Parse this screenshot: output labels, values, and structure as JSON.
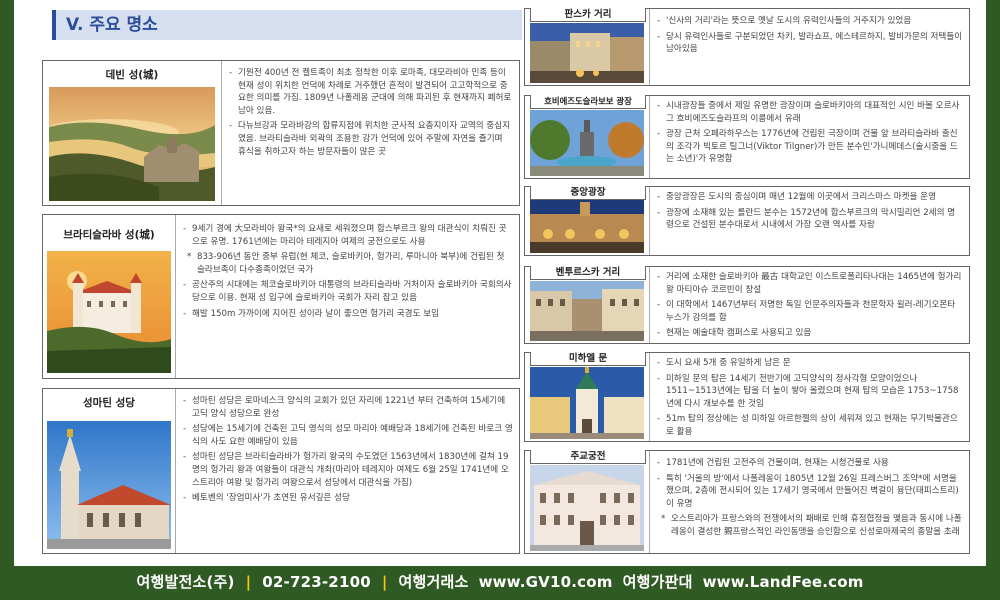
{
  "section": {
    "title": "V. 주요 명소"
  },
  "left_cards": [
    {
      "title": "데빈 성(城)",
      "items": [
        "기원전 400년 전 켈트족이 최초 정착한 이후 로마족, 대모라비아 민족 등이 현재 성이 위치한 언덕에 차례로 거주했던 흔적이 발견되어 고고학적으로 중요한 의미를 가짐. 1809년 나폴레옹 군대에 의해 파괴된 후 현재까지 폐허로 남아 있음.",
        "다뉴브강과 모라바강의 합류지점에 위치한 군사적 요충지이자 교역의 중심지였음. 브라티슬라바 외곽의 조용한 강가 언덕에 있어 주말에 자연을 즐기며 휴식을 취하고자 하는 방문자들이 많은 곳"
      ]
    },
    {
      "title": "브라티슬라바 성(城)",
      "items": [
        "9세기 경에 大모라비아 왕국*의 요새로 세워졌으며 합스부르크 왕의 대관식이 치뤄진 곳으로 유명. 1761년에는 마리아 테레지아 여제의 궁전으로도 사용",
        "833-906년 동안 중부 유럽(현 체코, 슬로바키아, 헝가리, 루마니아 북부)에 건립된 첫 슬라브족이 다수종족이었던 국가",
        "공산주의 시대에는 체코슬로바키아 대통령의 브라티슬라바 거처이자 슬로바키아 국회의사당으로 이용. 현재 성 입구에 슬로바키아 국회가 자리 잡고 있음",
        "해발 150m 가까이에 지어진 성이라 날이 좋으면 헝가리 국경도 보임"
      ]
    },
    {
      "title": "성마틴 성당",
      "items": [
        "성마틴 성당은 로마네스크 양식의 교회가 있던 자리에 1221년 부터 건축하여 15세기에 고딕 양식 성당으로 완성",
        "성당에는 15세기에 건축된 고딕 영식의 성모 마리아 예배당과 18세기에 건축된 바로크 영식의 사도 요한 예배당이 있음",
        "성마틴 성당은 브라티슬라바가 헝가리 왕국의 수도였던 1563년에서 1830년에 걸쳐 19명의 헝가리 왕과 여왕들이 대관식 개최(마리아 테레지아 여제도 6월 25일 1741년에 오스트리아 여왕 및 헝가리 여왕으로서 성당에서 대관식을 가짐)",
        "베토벤의 '장엄미사'가 초연된 유서깊은 성당"
      ]
    }
  ],
  "right_cards": [
    {
      "title": "판스카 거리",
      "items": [
        "'신사의 거리'라는 뜻으로 옛날 도시의 유력인사들의 거주지가 있었음",
        "당시 유력인사들로 구분되었던 차키, 발라쇼프, 에스테르하지, 발비가문의 저택들이 남아있음"
      ]
    },
    {
      "title": "흐비에즈도슬라보보 광장",
      "items": [
        "시내광장들 중에서 제일 유명한 광장이며 슬로바키아의 대표적인 시인 바볼 오르사그 흐비에즈도슬라프의 이름에서 유래",
        "광장 근처 오페라하우스는 1776년에 건립된 극장이며 건물 앞 브라티슬라바 출신의 조각가 빅토르 틸그너(Viktor Tilgner)가 만든 분수인'가니메데스(술시중을 드는 소년)'가 유명함"
      ]
    },
    {
      "title": "중앙광장",
      "items": [
        "중앙광장은 도시의 중심이며 매년 12월에 이곳에서 크리스마스 마켓을 운영",
        "광장에 소재해 있는 롤란드 분수는 1572년에 합스부르크의 막시밀리언 2세의 명령으로 건설된 분수대로서 시내에서 가장 오랜 역사를 자랑"
      ]
    },
    {
      "title": "벤투르스카 거리",
      "items": [
        "거리에 소재한 슬로바키아 最古 대학교인 이스트로폴리타나대는 1465년에 헝가리 왕 마티아슈 코르빈이 창설",
        "이 대학에서 1467년부터 저명한 독일 인문주의자들과 천문학자 윌러-레기오몬타누스가 강의를 함",
        "현재는 예술대학 캠퍼스로 사용되고 있음"
      ]
    },
    {
      "title": "미하엘 문",
      "items": [
        "도시 요새 5개 중 유일하게 남은 문",
        "미하일 문의 탑은 14세기 전반기에 고딕양식의 정사각형 모양이었으나 1511~1513년에는 탑을 더 높이 쌓아 올렸으며 현재 탑의 모습은 1753~1758년에 다시 개보수를 한 것임",
        "51m 탑의 정상에는 성 미하일 아르한젤의 상이 세워져 있고 현재는 무기박물관으로 활용"
      ]
    },
    {
      "title": "주교궁전",
      "items": [
        "1781년에 건립된 고전주의 건물이며, 현재는 시청건물로 사용",
        "특히 '거울의 방'에서 나폴레옹이 1805년 12월 26일 프레스버그 조약*에 서명을 했으며, 2층에 전시되어 있는 17세기 영국에서 만들어진 벽걸이 융단(태피스트리)이 유명",
        "오스트리아가 프랑스와의 전쟁에서의 패배로 인해 휴정협정을 맺음과 동시에 나폴레옹이 결성한 親프랑스적인 라인동맹을 승인함으로 신성로마제국의 종말을 초래"
      ]
    }
  ],
  "footer": {
    "company": "여행발전소(주)",
    "phone": "02-723-2100",
    "brand1": "여행거래소",
    "url1": "www.GV10.com",
    "brand2": "여행가판대",
    "url2": "www.LandFee.com"
  }
}
